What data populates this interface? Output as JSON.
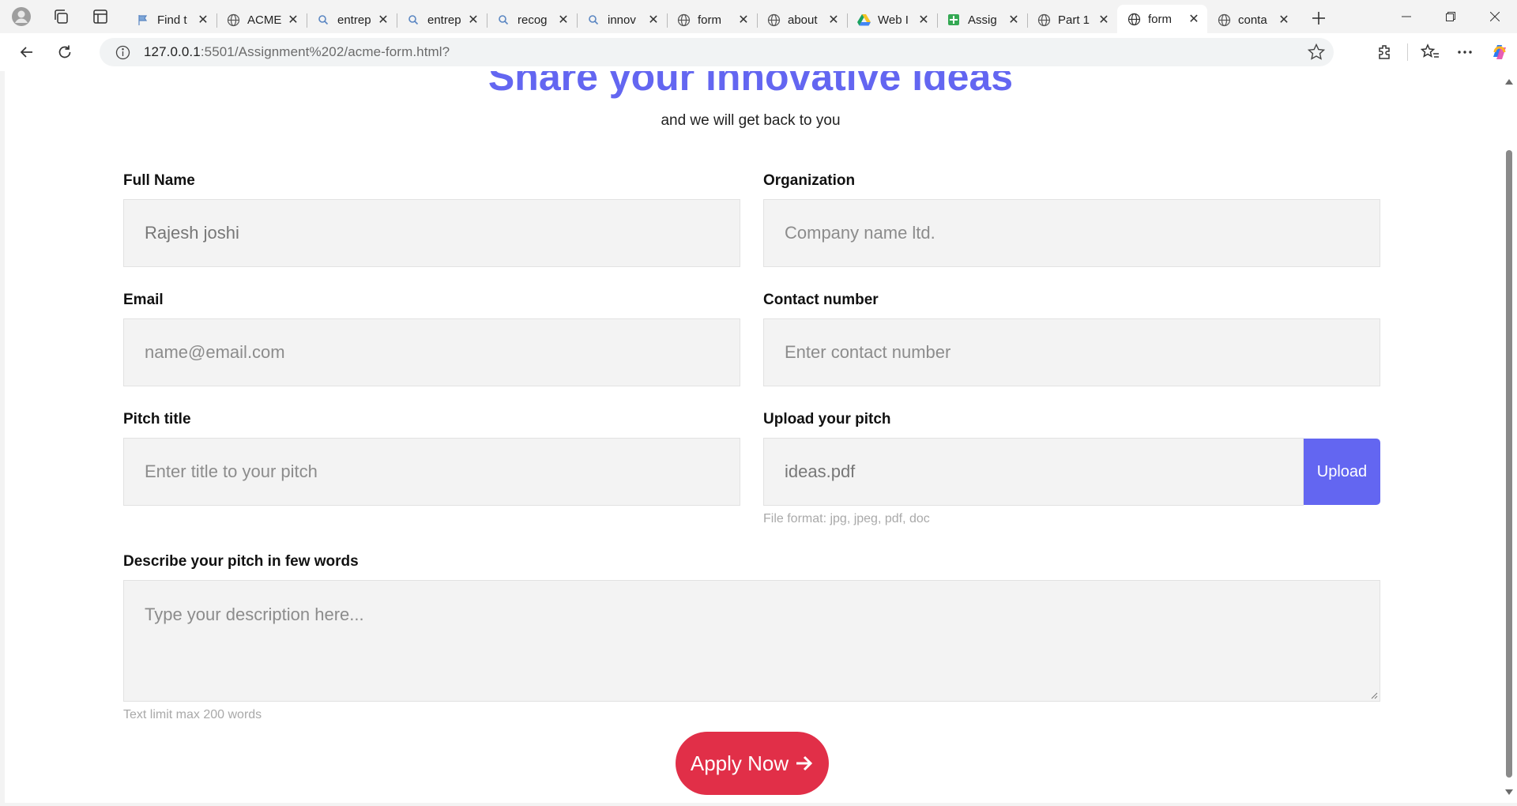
{
  "browser": {
    "tabs": [
      {
        "title": "Find t",
        "icon": "flag-icon"
      },
      {
        "title": "ACME",
        "icon": "globe-icon"
      },
      {
        "title": "entrep",
        "icon": "search-icon"
      },
      {
        "title": "entrep",
        "icon": "search-icon"
      },
      {
        "title": "recog",
        "icon": "search-icon"
      },
      {
        "title": "innov",
        "icon": "search-icon"
      },
      {
        "title": "form",
        "icon": "globe-icon"
      },
      {
        "title": "about",
        "icon": "globe-icon"
      },
      {
        "title": "Web I",
        "icon": "drive-icon"
      },
      {
        "title": "Assig",
        "icon": "sheets-icon"
      },
      {
        "title": "Part 1",
        "icon": "globe-icon"
      },
      {
        "title": "form",
        "icon": "globe-icon",
        "active": true
      },
      {
        "title": "conta",
        "icon": "globe-icon"
      }
    ],
    "url_host": "127.0.0.1",
    "url_rest": ":5501/Assignment%202/acme-form.html?"
  },
  "page": {
    "title": "Share your innovative ideas",
    "subtitle": "and we will get back to you",
    "fields": {
      "full_name": {
        "label": "Full Name",
        "value": "Rajesh joshi"
      },
      "organization": {
        "label": "Organization",
        "placeholder": "Company name ltd."
      },
      "email": {
        "label": "Email",
        "placeholder": "name@email.com"
      },
      "contact": {
        "label": "Contact number",
        "placeholder": "Enter contact number"
      },
      "pitch_title": {
        "label": "Pitch title",
        "placeholder": "Enter title to your pitch"
      },
      "upload": {
        "label": "Upload your pitch",
        "value": "ideas.pdf",
        "button": "Upload",
        "hint": "File format: jpg, jpeg, pdf, doc"
      },
      "description": {
        "label": "Describe your pitch in few words",
        "placeholder": "Type your description here...",
        "hint": "Text limit max 200 words"
      }
    },
    "apply_label": "Apply Now",
    "colors": {
      "accent": "#6366f1",
      "apply": "#e12f48"
    }
  }
}
